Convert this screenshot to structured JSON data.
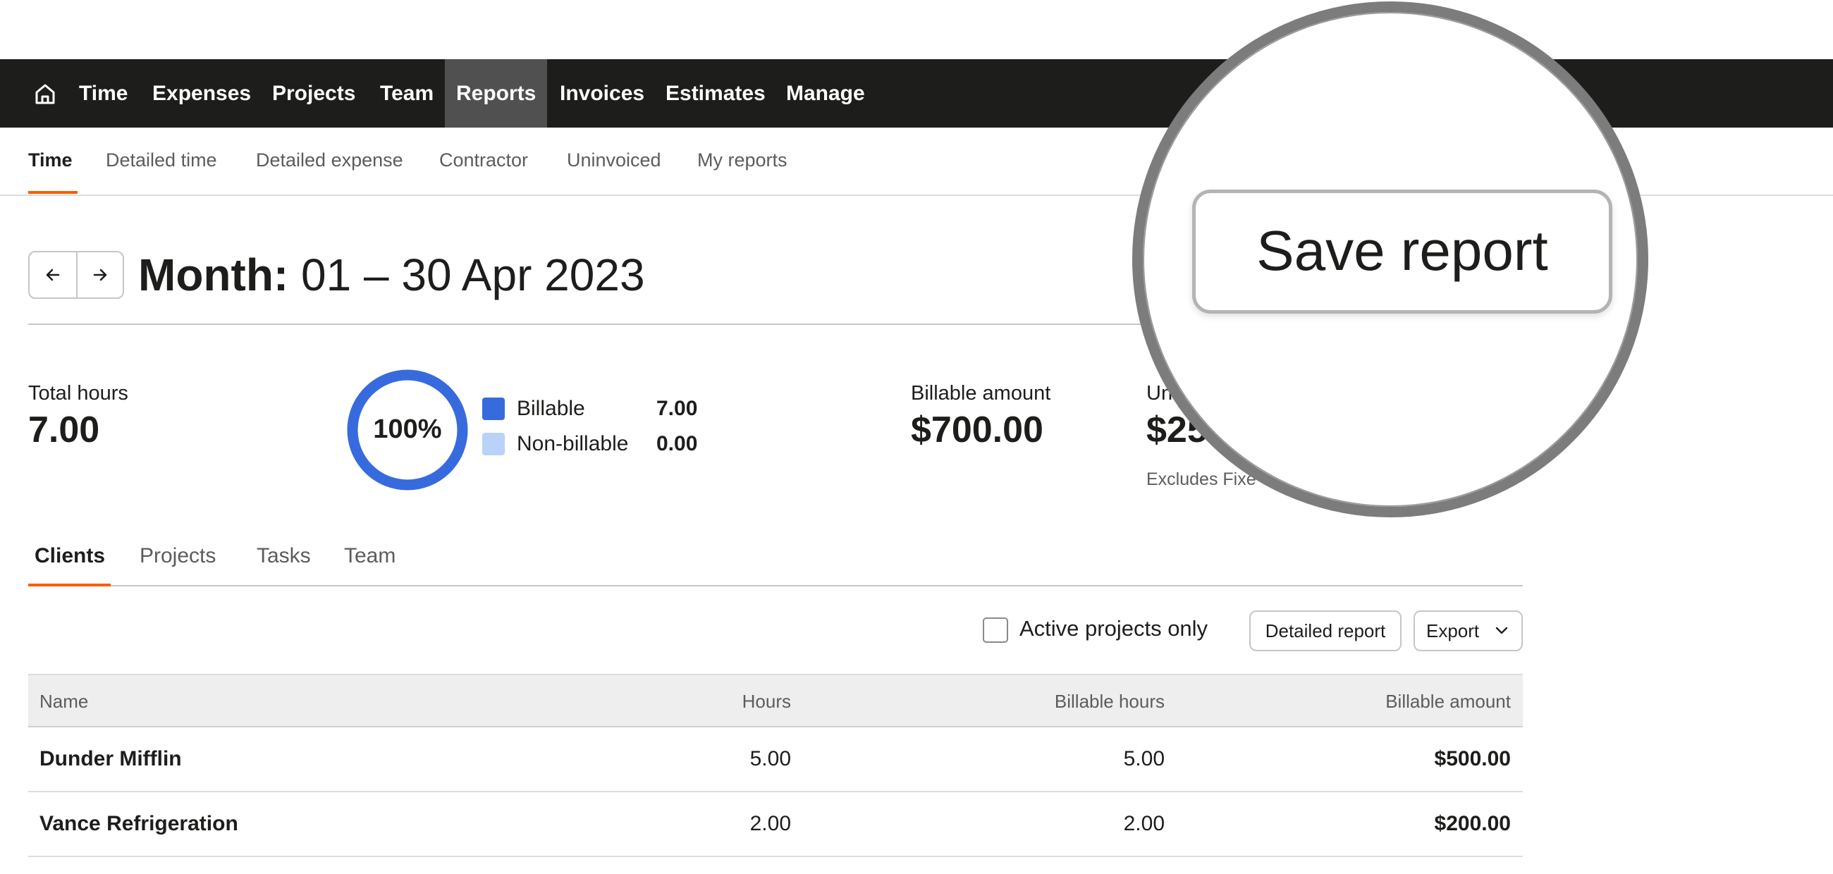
{
  "nav": {
    "items": [
      "Time",
      "Expenses",
      "Projects",
      "Team",
      "Reports",
      "Invoices",
      "Estimates",
      "Manage"
    ],
    "active": "Reports",
    "home_icon": "home-icon"
  },
  "subtabs": {
    "items": [
      "Time",
      "Detailed time",
      "Detailed expense",
      "Contractor",
      "Uninvoiced",
      "My reports"
    ],
    "active": "Time"
  },
  "period": {
    "prefix": "Month:",
    "range": "01 – 30 Apr 2023",
    "prev_icon": "arrow-left-icon",
    "next_icon": "arrow-right-icon"
  },
  "summary": {
    "total_hours_label": "Total hours",
    "total_hours_value": "7.00",
    "donut_percent_label": "100%",
    "billable_fraction": 1.0,
    "legend": [
      {
        "label": "Billable",
        "value": "7.00",
        "color": "#376bdd"
      },
      {
        "label": "Non-billable",
        "value": "0.00",
        "color": "#b9d2f7"
      }
    ],
    "billable_amount_label": "Billable amount",
    "billable_amount_value": "$700.00",
    "uninvoiced_label_partial": "Un",
    "uninvoiced_value_partial": "$25",
    "uninvoiced_note_partial": "Excludes Fixe"
  },
  "section_tabs": {
    "items": [
      "Clients",
      "Projects",
      "Tasks",
      "Team"
    ],
    "active": "Clients"
  },
  "toolbar": {
    "active_only_label": "Active projects only",
    "active_only_checked": false,
    "detailed_report_label": "Detailed report",
    "export_label": "Export",
    "export_icon": "chevron-down-icon"
  },
  "table": {
    "columns": [
      "Name",
      "Hours",
      "Billable hours",
      "Billable amount"
    ],
    "rows": [
      {
        "name": "Dunder Mifflin",
        "hours": "5.00",
        "billable_hours": "5.00",
        "billable_amount": "$500.00"
      },
      {
        "name": "Vance Refrigeration",
        "hours": "2.00",
        "billable_hours": "2.00",
        "billable_amount": "$200.00"
      }
    ]
  },
  "magnifier": {
    "save_report_label": "Save report"
  },
  "colors": {
    "nav_bg": "#1d1e1c",
    "nav_active_bg": "#505050",
    "accent": "#fa5d00",
    "billable": "#376bdd",
    "non_billable": "#b9d2f7"
  }
}
